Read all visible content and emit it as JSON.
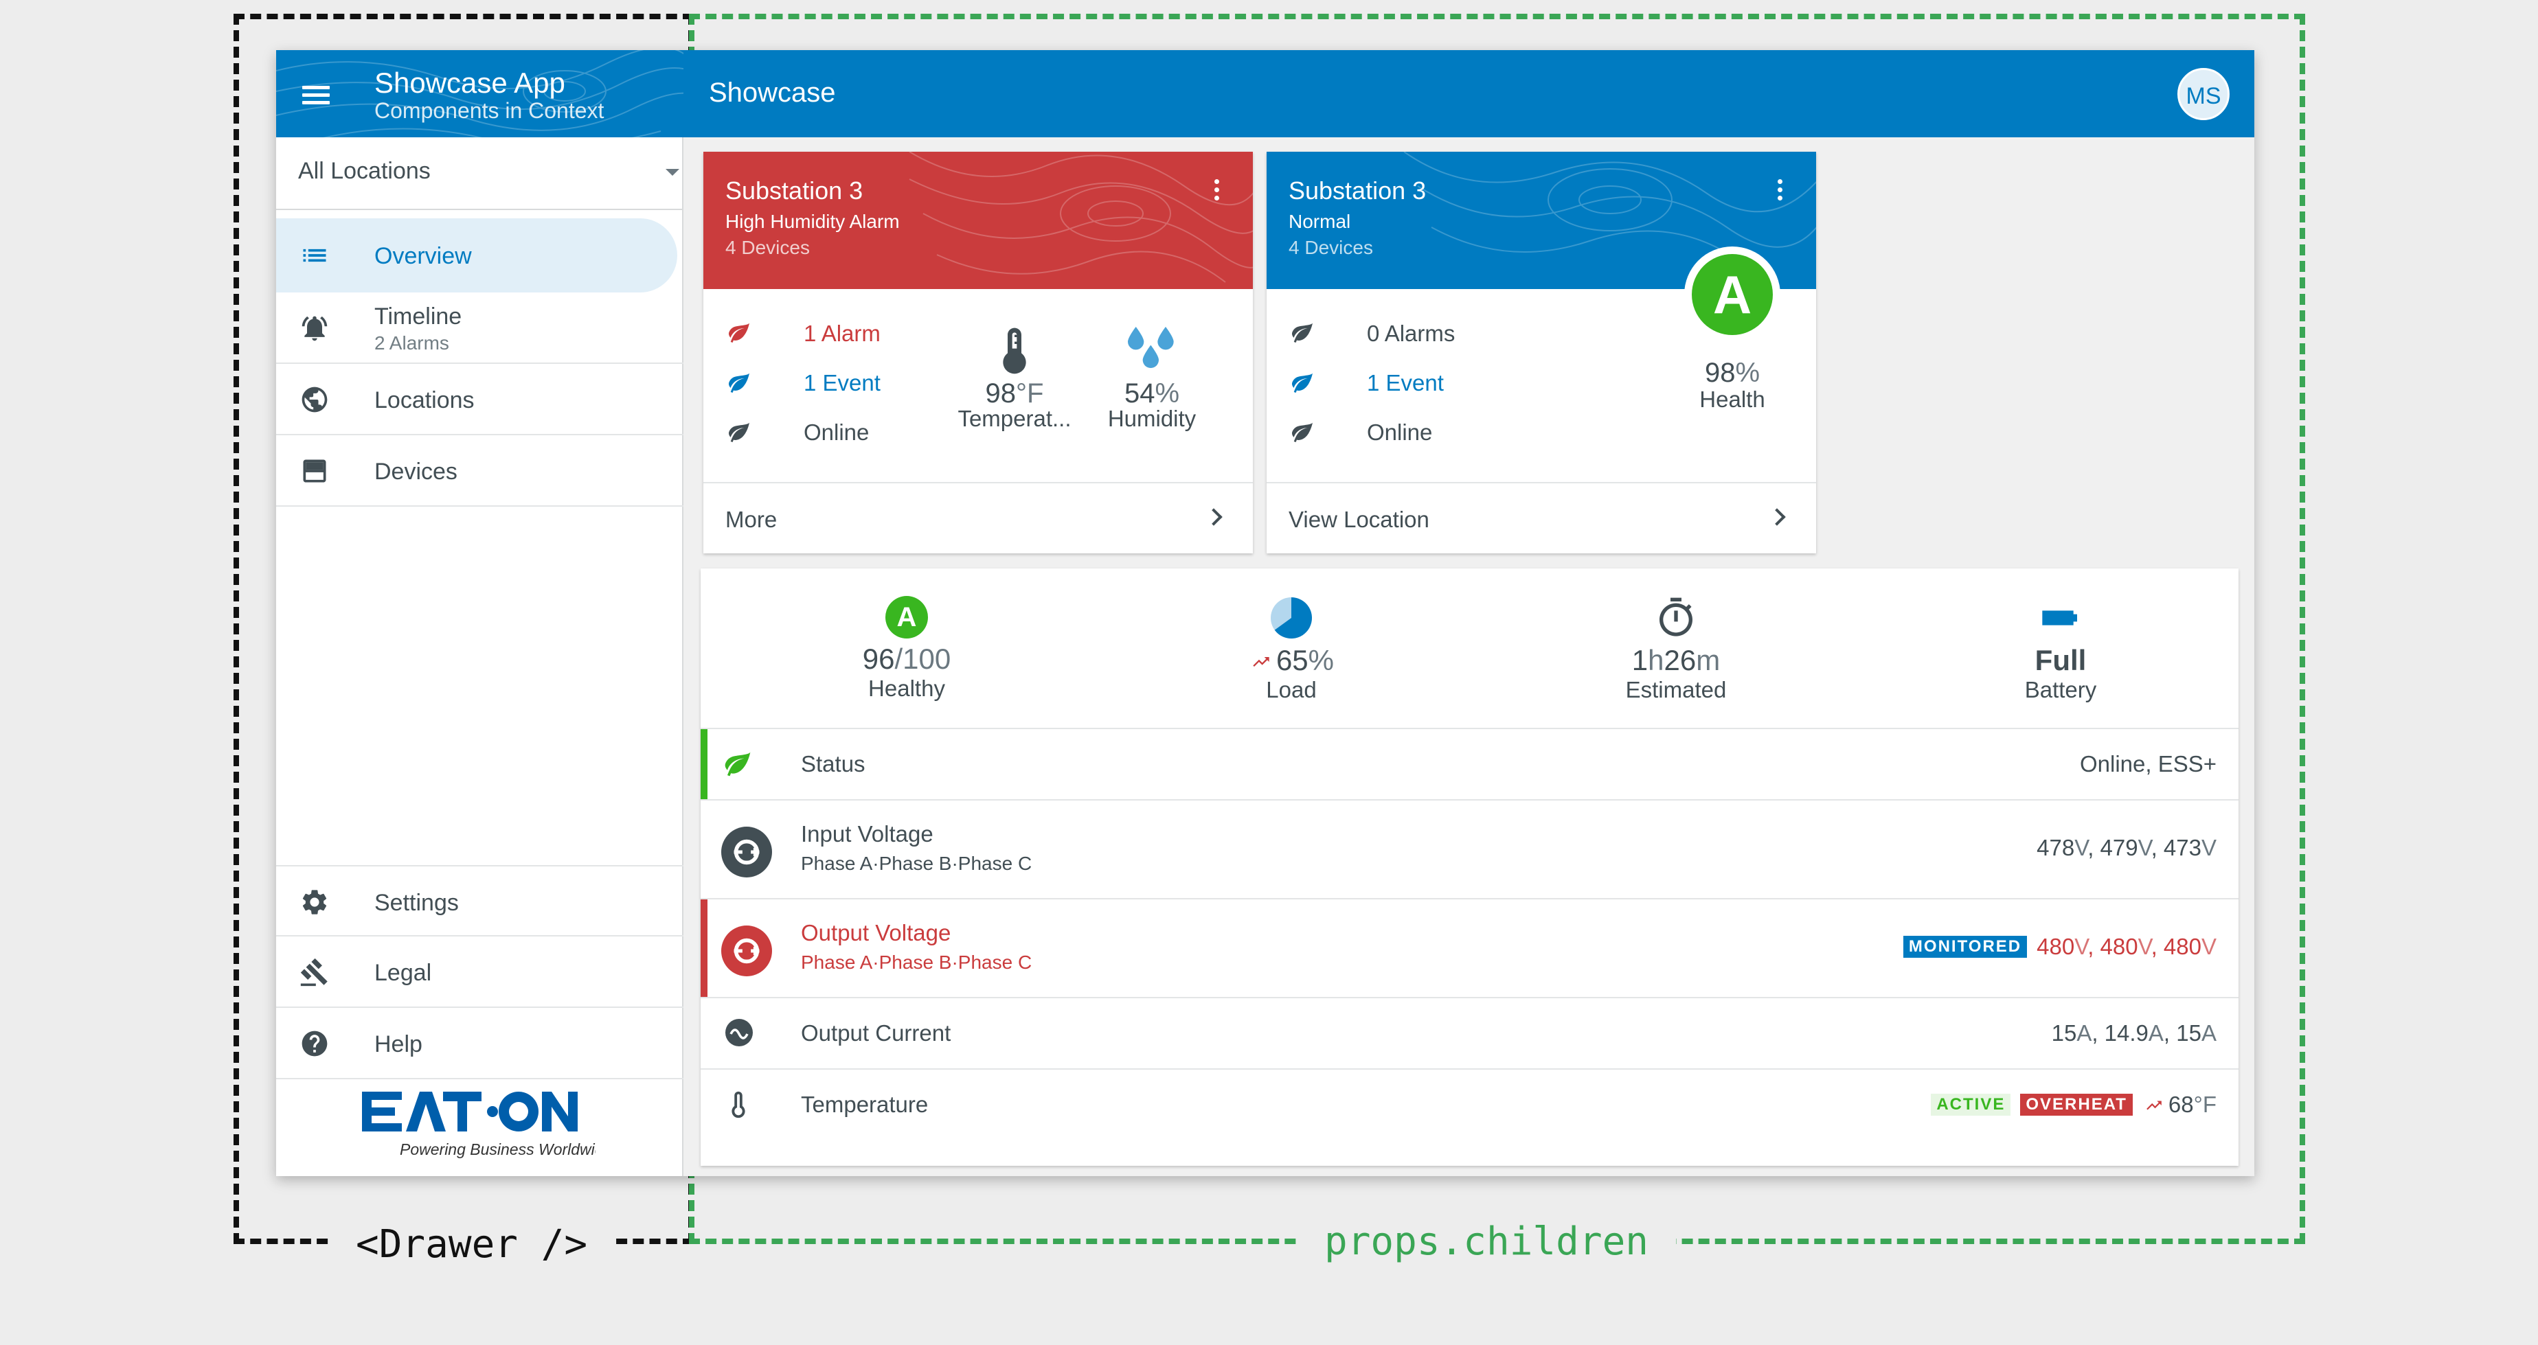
{
  "captions": {
    "drawer": "<Drawer />",
    "children": "props.children"
  },
  "drawer": {
    "title": "Showcase App",
    "subtitle": "Components in Context",
    "location_select": "All Locations",
    "nav": [
      {
        "label": "Overview"
      },
      {
        "label": "Timeline",
        "sub": "2 Alarms"
      },
      {
        "label": "Locations"
      },
      {
        "label": "Devices"
      }
    ],
    "footer_nav": [
      {
        "label": "Settings"
      },
      {
        "label": "Legal"
      },
      {
        "label": "Help"
      }
    ],
    "logo_tagline": "Powering Business Worldwide",
    "logo_text": "EATON"
  },
  "appbar": {
    "title": "Showcase",
    "avatar": "MS"
  },
  "cards": [
    {
      "title": "Substation 3",
      "subtitle": "High Humidity Alarm",
      "info": "4 Devices",
      "color": "#ca3c3d",
      "rows": [
        "1 Alarm",
        "1 Event",
        "Online"
      ],
      "temp_value": "98",
      "temp_unit": "°F",
      "temp_label": "Temperat...",
      "hum_value": "54",
      "hum_unit": "%",
      "hum_label": "Humidity",
      "footer": "More"
    },
    {
      "title": "Substation 3",
      "subtitle": "Normal",
      "info": "4 Devices",
      "color": "#007bc1",
      "rows": [
        "0 Alarms",
        "1 Event",
        "Online"
      ],
      "grade": "A",
      "health_value": "98",
      "health_unit": "%",
      "health_label": "Health",
      "footer": "View Location"
    }
  ],
  "heroes": [
    {
      "value": "96",
      "unit": "/100",
      "label": "Healthy",
      "icon": "grade-a-icon"
    },
    {
      "value": "65",
      "unit": "%",
      "label": "Load",
      "icon": "pie-icon",
      "fraction": 0.65
    },
    {
      "value": "1",
      "unit": "h",
      "value2": "26",
      "unit2": "m",
      "label": "Estimated",
      "icon": "timer-icon"
    },
    {
      "value": "Full",
      "unit": "",
      "label": "Battery",
      "icon": "battery-icon"
    }
  ],
  "info_list": {
    "status": {
      "title": "Status",
      "value": "Online, ESS+"
    },
    "input_voltage": {
      "title": "Input Voltage",
      "sub": "Phase A·Phase B·Phase C",
      "v1": "478",
      "v2": "479",
      "v3": "473",
      "unit": "V"
    },
    "output_voltage": {
      "title": "Output Voltage",
      "sub": "Phase A·Phase B·Phase C",
      "chip": "MONITORED",
      "v1": "480",
      "v2": "480",
      "v3": "480",
      "unit": "V"
    },
    "output_current": {
      "title": "Output Current",
      "v1": "15",
      "v2": "14.9",
      "v3": "15",
      "unit": "A"
    },
    "temperature": {
      "title": "Temperature",
      "chip1": "ACTIVE",
      "chip2": "OVERHEAT",
      "value": "68",
      "unit": "°F"
    }
  },
  "colors": {
    "primary": "#007bc1",
    "danger": "#ca3c3d",
    "success": "#39b620",
    "text": "#424e54"
  }
}
